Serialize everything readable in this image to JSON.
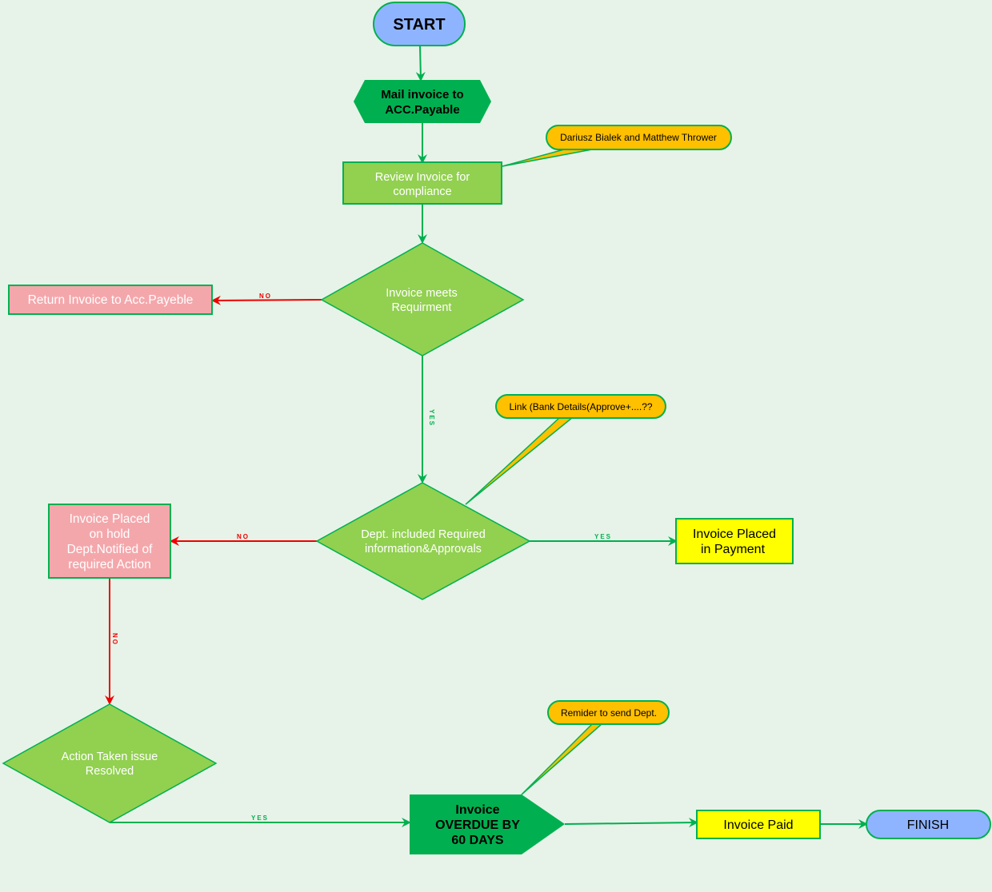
{
  "colors": {
    "background": "#e7f3e8",
    "stroke": "#00b050",
    "process": "#92d050",
    "terminal": "#8fb4ff",
    "reject": "#f4a7ab",
    "success": "#ffff00",
    "callout": "#ffc000",
    "dark_process": "#00b050",
    "no_edge": "#ee0000"
  },
  "nodes": {
    "start": "START",
    "mail": [
      "Mail invoice to",
      "ACC.Payable"
    ],
    "review": [
      "Review Invoice for",
      "compliance"
    ],
    "meets": [
      "Invoice meets",
      "Requirment"
    ],
    "return": "Return Invoice to Acc.Payeble",
    "dept": [
      "Dept. included Required",
      "information&Approvals"
    ],
    "hold": [
      "Invoice Placed",
      "on hold",
      "Dept.Notified of",
      "required Action"
    ],
    "payment": [
      "Invoice Placed",
      "in Payment"
    ],
    "resolved": [
      "Action Taken issue",
      "Resolved"
    ],
    "overdue": [
      "Invoice",
      "OVERDUE BY",
      "60 DAYS"
    ],
    "paid": "Invoice Paid",
    "finish": "FINISH"
  },
  "callouts": {
    "reviewers": "Dariusz Bialek and Matthew Thrower",
    "link": "Link (Bank Details(Approve+....??",
    "reminder": "Remider to send Dept."
  },
  "edges": {
    "no": "NO",
    "yes": "YES"
  }
}
